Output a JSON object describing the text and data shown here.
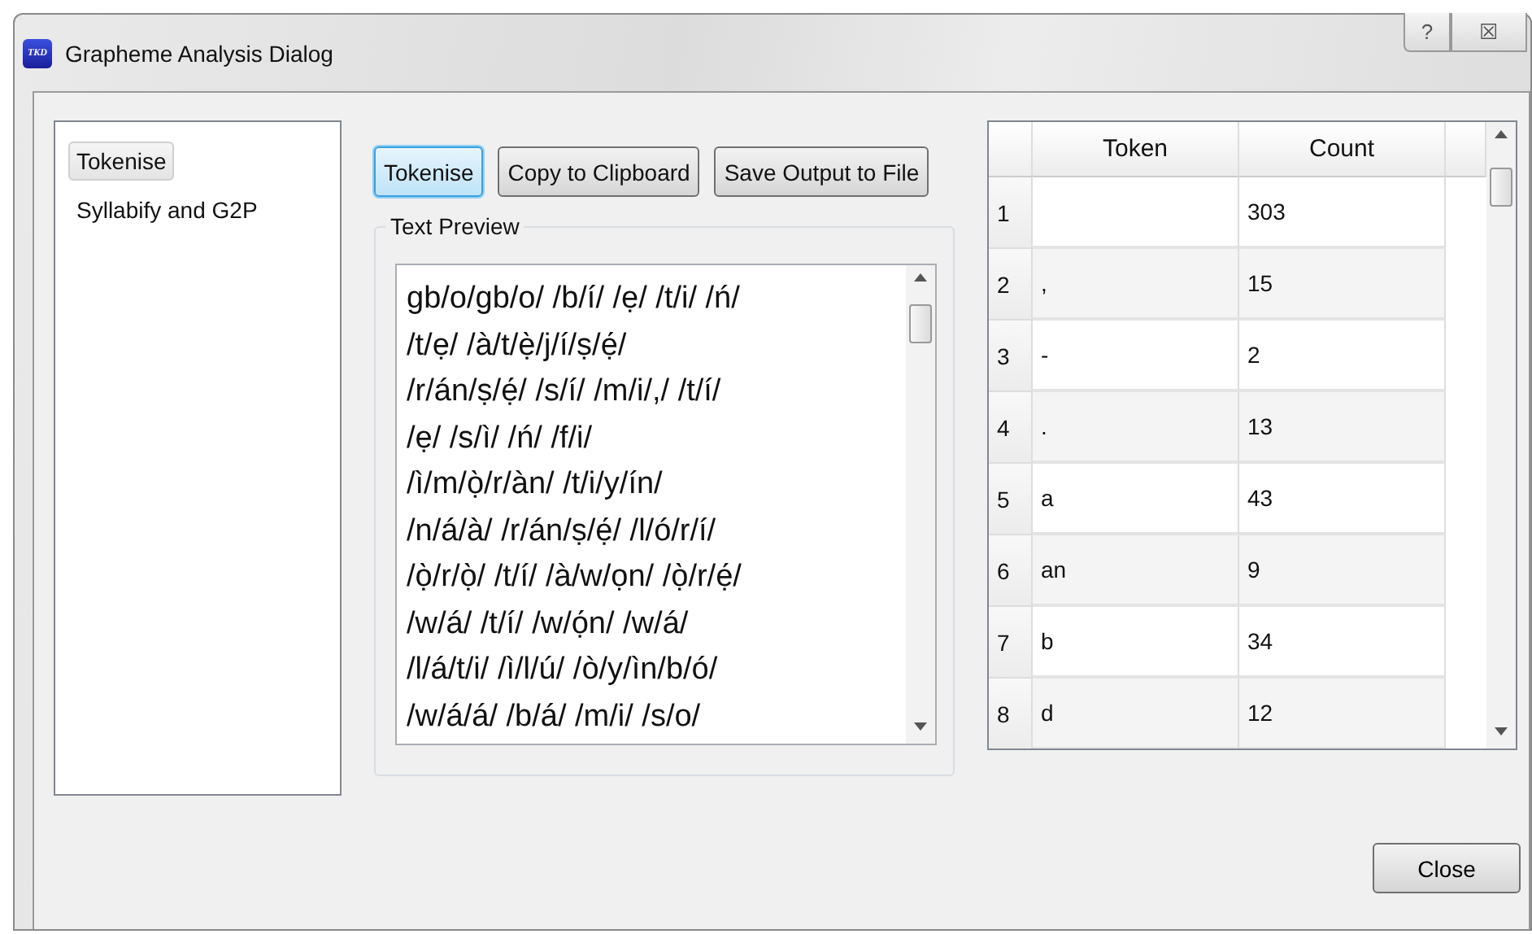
{
  "window": {
    "title": "Grapheme Analysis Dialog",
    "icon_text": "TKD",
    "controls": [
      "?",
      "☒"
    ]
  },
  "sidebar": {
    "items": [
      {
        "label": "Tokenise",
        "selected": true
      },
      {
        "label": "Syllabify and G2P",
        "selected": false
      }
    ]
  },
  "toolbar": {
    "buttons": [
      {
        "label": "Tokenise",
        "focused": true
      },
      {
        "label": "Copy to Clipboard",
        "focused": false
      },
      {
        "label": "Save Output to File",
        "focused": false
      }
    ]
  },
  "text_preview": {
    "title": "Text Preview",
    "lines": [
      "gb/o/gb/o/ /b/í/ /ẹ/ /t/i/ /ń/",
      "/t/ẹ/ /à/t/ẹ̀/j/í/ṣ/ẹ́/",
      "/r/án/ṣ/ẹ́/ /s/í/ /m/i/,/ /t/í/",
      "/ẹ/ /s/ì/ /ń/ /f/i/",
      "/ì/m/ọ̀/r/àn/ /t/i/y/ín/",
      "/n/á/à/ /r/án/ṣ/ẹ́/ /l/ó/r/í/",
      "/ọ̀/r/ọ̀/ /t/í/ /à/w/ọn/ /ọ̀/r/ẹ́/",
      "/w/á/ /t/í/ /w/ọ́n/ /w/á/",
      "/l/á/t/i/ /ì/l/ú/ /ò/y/ìn/b/ó/",
      "/w/á/á/ /b/á/ /m/i/ /s/o/"
    ]
  },
  "table": {
    "columns": [
      "Token",
      "Count"
    ],
    "rows": [
      {
        "number": "1",
        "token": "",
        "count": "303"
      },
      {
        "number": "2",
        "token": ",",
        "count": "15"
      },
      {
        "number": "3",
        "token": "-",
        "count": "2"
      },
      {
        "number": "4",
        "token": ".",
        "count": "13"
      },
      {
        "number": "5",
        "token": "a",
        "count": "43"
      },
      {
        "number": "6",
        "token": "an",
        "count": "9"
      },
      {
        "number": "7",
        "token": "b",
        "count": "34"
      },
      {
        "number": "8",
        "token": "d",
        "count": "12"
      }
    ]
  },
  "close_button": "Close"
}
